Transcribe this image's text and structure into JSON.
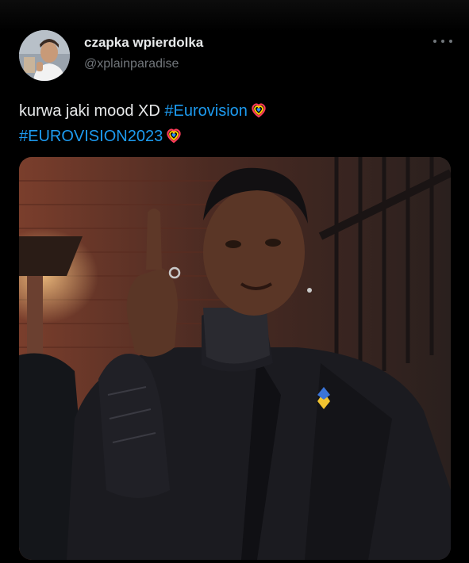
{
  "user": {
    "display_name": "czapka wpierdolka",
    "handle": "@xplainparadise",
    "avatar_icon": "profile-photo"
  },
  "more_icon": "more-options-icon",
  "tweet": {
    "text_prefix": "kurwa jaki mood XD ",
    "hashtags": [
      "#Eurovision",
      "#EUROVISION2023"
    ],
    "hashtag_emoji": "eurovision-heart-icon"
  },
  "media": {
    "type": "photo",
    "description_icon": "attached-photo"
  },
  "colors": {
    "background": "#000000",
    "text": "#e7e9ea",
    "secondary": "#71767b",
    "link": "#1d9bf0"
  }
}
